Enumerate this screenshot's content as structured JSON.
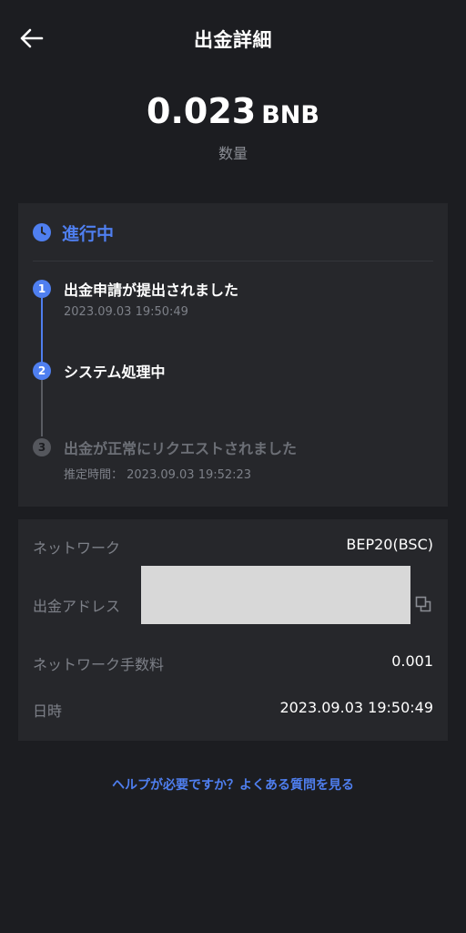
{
  "header": {
    "title": "出金詳細",
    "back_icon": "arrow-left-icon"
  },
  "amount": {
    "value": "0.023",
    "unit": "BNB",
    "label": "数量"
  },
  "status": {
    "title": "進行中",
    "icon": "clock-icon",
    "accent_color": "#4f7ff0",
    "steps": [
      {
        "num": "1",
        "title": "出金申請が提出されました",
        "sub": "2023.09.03 19:50:49",
        "state": "done"
      },
      {
        "num": "2",
        "title": "システム処理中",
        "sub": "",
        "state": "active"
      },
      {
        "num": "3",
        "title": "出金が正常にリクエストされました",
        "sub": "推定時間： 2023.09.03 19:52:23",
        "state": "pending"
      }
    ]
  },
  "details": {
    "network_label": "ネットワーク",
    "network_value": "BEP20(BSC)",
    "address_label": "出金アドレス",
    "fee_label": "ネットワーク手数料",
    "fee_value": "0.001",
    "datetime_label": "日時",
    "datetime_value": "2023.09.03 19:50:49",
    "copy_icon": "copy-icon"
  },
  "help": {
    "link_text": "ヘルプが必要ですか？よくある質問を見る"
  }
}
